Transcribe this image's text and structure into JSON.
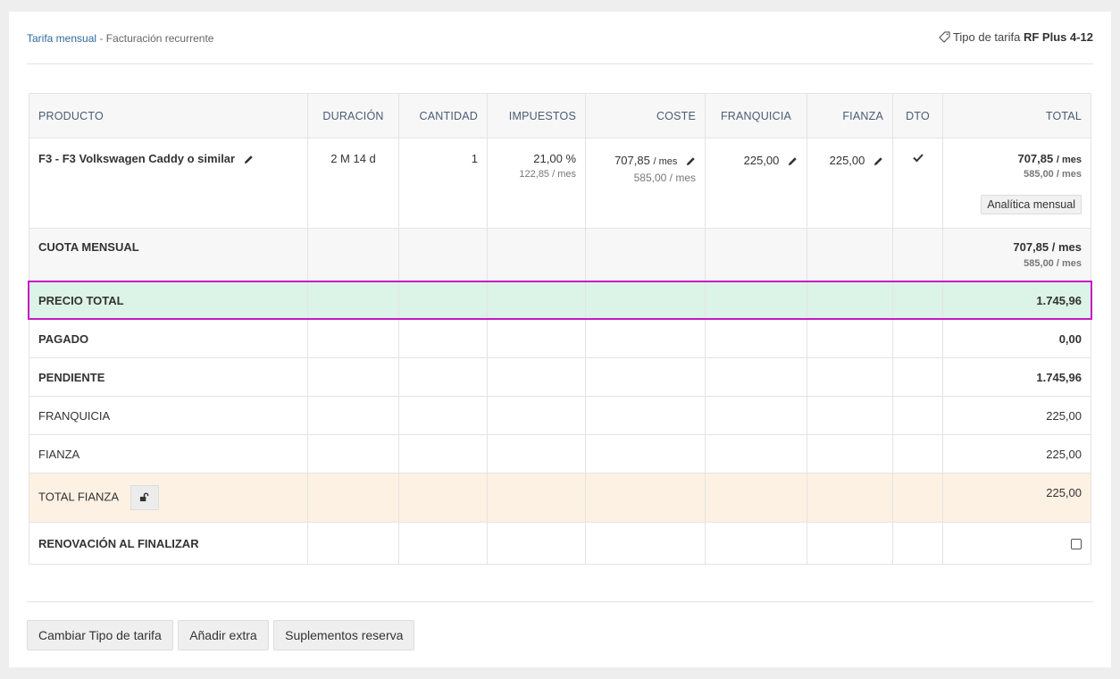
{
  "header": {
    "tariff_link": "Tarifa mensual",
    "separator": "-",
    "billing": "Facturación recurrente",
    "tariff_type_label": "Tipo de tarifa",
    "tariff_type_value": "RF Plus 4-12"
  },
  "table": {
    "columns": [
      "PRODUCTO",
      "DURACIÓN",
      "CANTIDAD",
      "IMPUESTOS",
      "COSTE",
      "FRANQUICIA",
      "FIANZA",
      "DTO",
      "TOTAL"
    ],
    "product": {
      "name": "F3 - F3 Volkswagen Caddy o similar",
      "duration": "2 M 14 d",
      "quantity": "1",
      "tax_percent": "21,00 %",
      "tax_monthly": "122,85 / mes",
      "cost": "707,85",
      "cost_unit": "/ mes",
      "cost_net": "585,00 / mes",
      "franchise": "225,00",
      "deposit": "225,00",
      "total": "707,85",
      "total_unit": "/ mes",
      "total_net": "585,00 / mes",
      "analytics_button": "Analítica mensual"
    },
    "cuota": {
      "label": "CUOTA MENSUAL",
      "total": "707,85 / mes",
      "total_net": "585,00 / mes"
    },
    "precio_total": {
      "label": "PRECIO TOTAL",
      "value": "1.745,96"
    },
    "pagado": {
      "label": "PAGADO",
      "value": "0,00"
    },
    "pendiente": {
      "label": "PENDIENTE",
      "value": "1.745,96"
    },
    "franquicia": {
      "label": "FRANQUICIA",
      "value": "225,00"
    },
    "fianza": {
      "label": "FIANZA",
      "value": "225,00"
    },
    "total_fianza": {
      "label": "TOTAL FIANZA",
      "value": "225,00"
    },
    "renovacion": {
      "label": "RENOVACIÓN AL FINALIZAR"
    }
  },
  "footer": {
    "change_tariff": "Cambiar Tipo de tarifa",
    "add_extra": "Añadir extra",
    "supplements": "Suplementos reserva"
  },
  "colors": {
    "link": "#2c6aa0",
    "header_text": "#4b5c75",
    "total_row_bg": "#dcf3e7",
    "fianza_row_bg": "#fcf1e3",
    "pending_red": "#e60012",
    "highlight_border": "#c51ac5"
  },
  "icons": [
    "tag-icon",
    "pencil-icon",
    "check-icon",
    "unlock-icon"
  ]
}
